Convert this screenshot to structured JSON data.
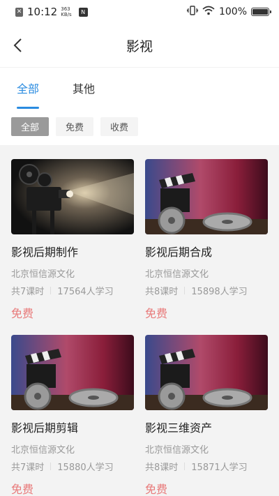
{
  "status_bar": {
    "time": "10:12",
    "speed_value": "363",
    "speed_unit": "KB/s",
    "battery": "100%"
  },
  "header": {
    "title": "影视"
  },
  "tabs": [
    {
      "label": "全部",
      "active": true
    },
    {
      "label": "其他",
      "active": false
    }
  ],
  "filters": [
    {
      "label": "全部",
      "active": true
    },
    {
      "label": "免费",
      "active": false
    },
    {
      "label": "收费",
      "active": false
    }
  ],
  "courses": [
    {
      "title": "影视后期制作",
      "org": "北京恒信源文化",
      "lessons": "共7课时",
      "learners": "17564人学习",
      "price": "免费",
      "thumb": "projector"
    },
    {
      "title": "影视后期合成",
      "org": "北京恒信源文化",
      "lessons": "共8课时",
      "learners": "15898人学习",
      "price": "免费",
      "thumb": "clapperboard"
    },
    {
      "title": "影视后期剪辑",
      "org": "北京恒信源文化",
      "lessons": "共7课时",
      "learners": "15880人学习",
      "price": "免费",
      "thumb": "clapperboard"
    },
    {
      "title": "影视三维资产",
      "org": "北京恒信源文化",
      "lessons": "共8课时",
      "learners": "15871人学习",
      "price": "免费",
      "thumb": "clapperboard"
    }
  ],
  "colors": {
    "accent": "#2a8be0",
    "price": "#e87a7a",
    "chip_active": "#9a9a9a"
  }
}
